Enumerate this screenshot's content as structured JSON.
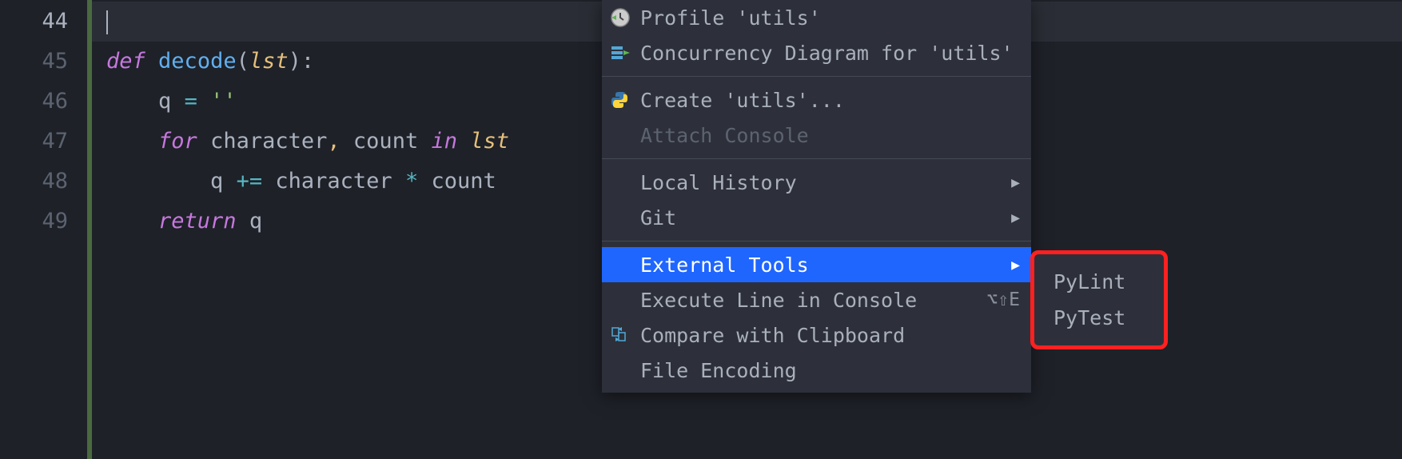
{
  "gutter": {
    "lines": [
      "44",
      "45",
      "46",
      "47",
      "48",
      "49"
    ],
    "currentLine": "44"
  },
  "code": {
    "line45": {
      "def": "def",
      "fname": "decode",
      "lp": "(",
      "param": "lst",
      "rp": ")",
      "colon": ":"
    },
    "line46": {
      "ident": "q",
      "eq": "=",
      "str": "''"
    },
    "line47": {
      "for": "for",
      "var1": "character",
      "comma": ",",
      "var2": "count",
      "in": "in",
      "iter": "lst"
    },
    "line48": {
      "ident": "q",
      "pluseq": "+=",
      "var1": "character",
      "star": "*",
      "var2": "count"
    },
    "line49": {
      "return": "return",
      "ident": "q"
    }
  },
  "menu": {
    "profile": "Profile 'utils'",
    "concurrency": "Concurrency Diagram for  'utils'",
    "create": "Create 'utils'...",
    "attach": "Attach Console",
    "localhistory": "Local History",
    "git": "Git",
    "externaltools": "External Tools",
    "executeline": "Execute Line in Console",
    "executeline_shortcut": "⌥⇧E",
    "compareclip": "Compare with Clipboard",
    "fileencoding": "File Encoding"
  },
  "submenu": {
    "pylint": "PyLint",
    "pytest": "PyTest"
  }
}
